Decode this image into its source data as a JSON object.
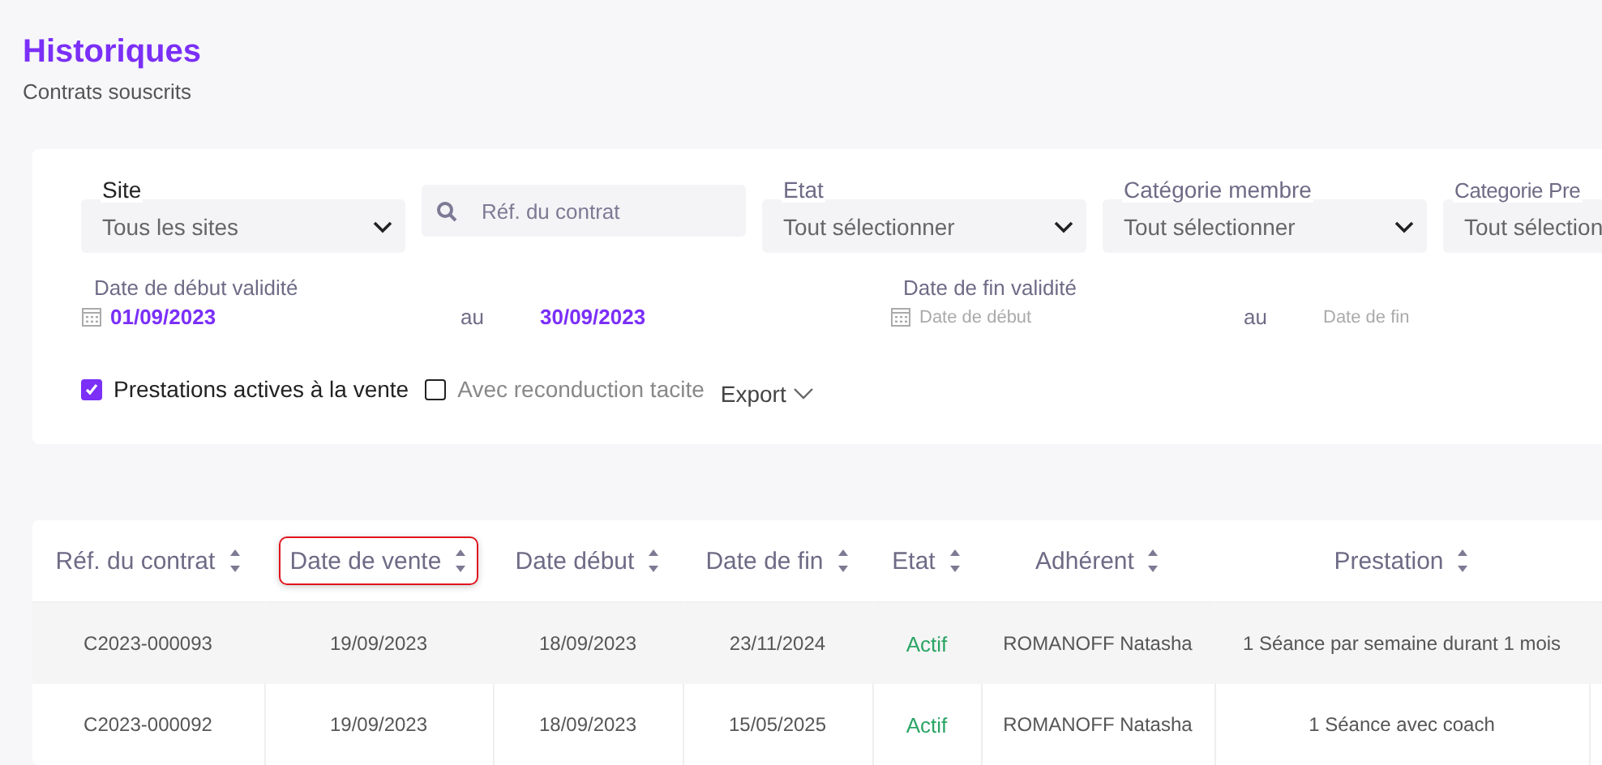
{
  "header": {
    "title": "Historiques",
    "subtitle": "Contrats souscrits"
  },
  "filters": {
    "selects": [
      {
        "label": "Site",
        "value": "Tous les sites",
        "kind": "select"
      },
      {
        "placeholder": "Réf. du contrat",
        "kind": "search"
      },
      {
        "label": "Etat",
        "value": "Tout sélectionner",
        "kind": "select"
      },
      {
        "label": "Catégorie membre",
        "value": "Tout sélectionner",
        "kind": "select"
      },
      {
        "label": "Categorie Pre",
        "value": "Tout sélection",
        "kind": "cut"
      }
    ],
    "date_ranges": [
      {
        "label": "Date de début validité",
        "from": {
          "value": "01/09/2023"
        },
        "separator": "au",
        "to": {
          "value": "30/09/2023"
        }
      },
      {
        "label": "Date de fin validité",
        "from": {
          "placeholder": "Date de début"
        },
        "separator": "au",
        "to": {
          "placeholder": "Date de fin"
        }
      }
    ],
    "checkboxes": [
      {
        "label": "Prestations actives à la vente",
        "checked": true
      },
      {
        "label": "Avec reconduction tacite",
        "checked": false
      }
    ],
    "export": "Export"
  },
  "table": {
    "columns": [
      {
        "label": "Réf. du contrat",
        "highlighted": false
      },
      {
        "label": "Date de vente",
        "highlighted": true
      },
      {
        "label": "Date début",
        "highlighted": false
      },
      {
        "label": "Date de fin",
        "highlighted": false
      },
      {
        "label": "Etat",
        "highlighted": false
      },
      {
        "label": "Adhérent",
        "highlighted": false
      },
      {
        "label": "Prestation",
        "highlighted": false
      }
    ],
    "rows": [
      {
        "cells": [
          "C2023-000093",
          "19/09/2023",
          "18/09/2023",
          "23/11/2024",
          "Actif",
          "ROMANOFF Natasha",
          "1 Séance par semaine durant 1 mois"
        ]
      },
      {
        "cells": [
          "C2023-000092",
          "19/09/2023",
          "18/09/2023",
          "15/05/2025",
          "Actif",
          "ROMANOFF Natasha",
          "1 Séance avec coach"
        ]
      }
    ]
  }
}
